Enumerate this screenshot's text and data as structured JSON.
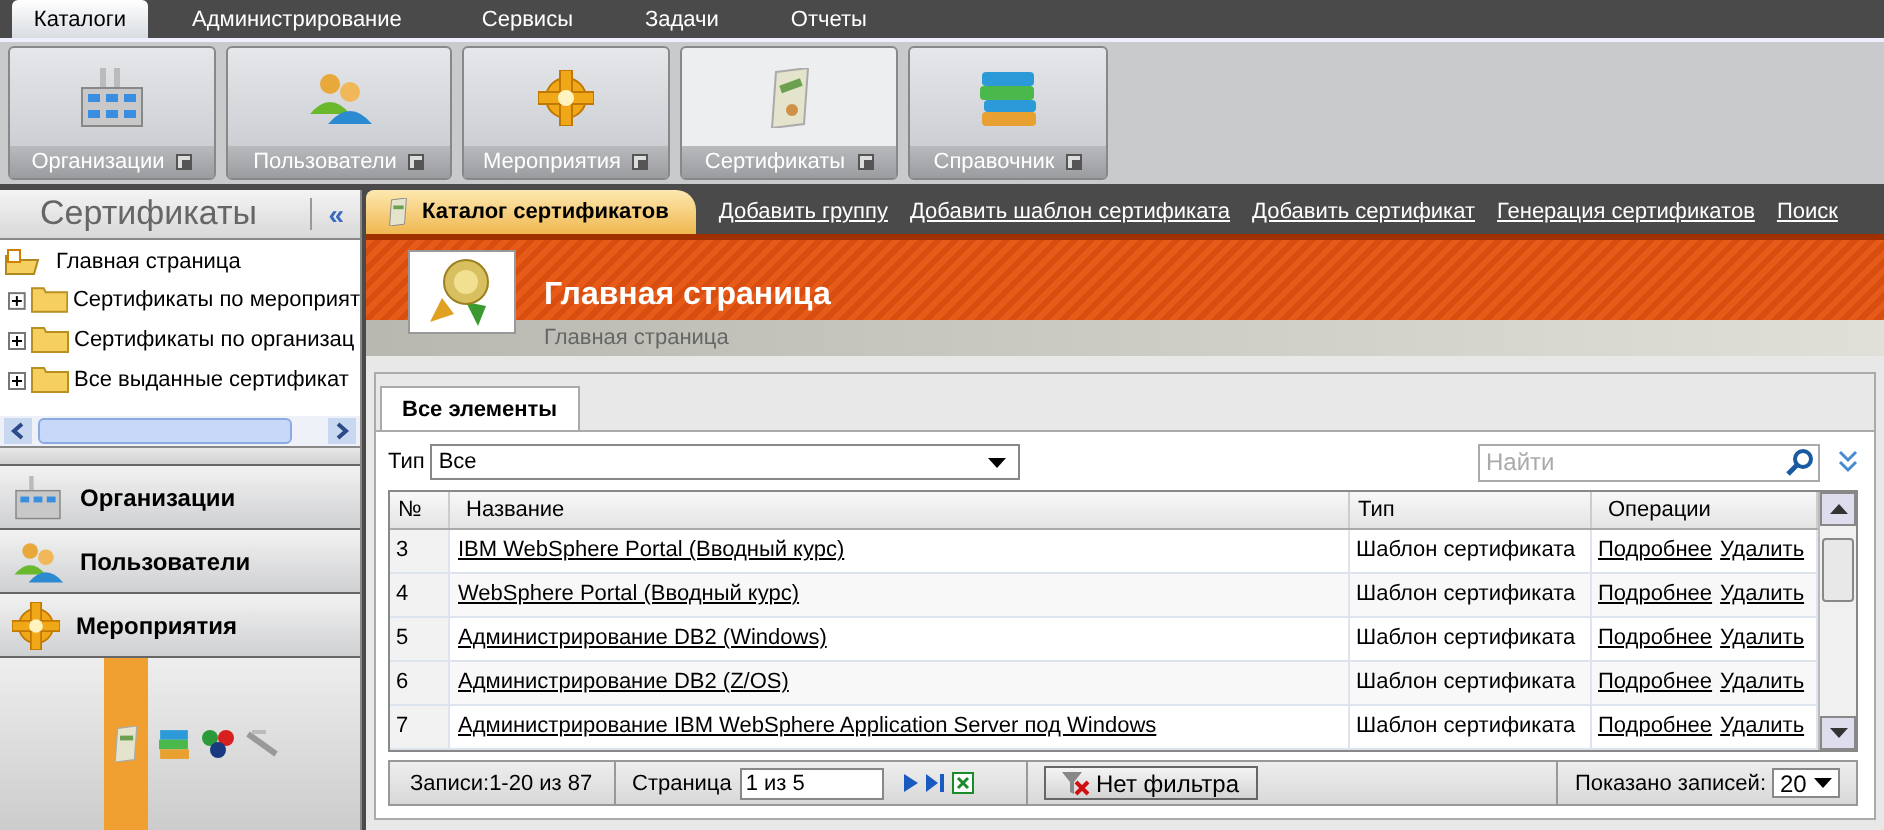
{
  "top_tabs": [
    {
      "label": "Каталоги",
      "selected": true
    },
    {
      "label": "Администрирование",
      "selected": false
    },
    {
      "label": "Сервисы",
      "selected": false
    },
    {
      "label": "Задачи",
      "selected": false
    },
    {
      "label": "Отчеты",
      "selected": false
    }
  ],
  "ribbon": [
    {
      "label": "Организации",
      "selected": false
    },
    {
      "label": "Пользователи",
      "selected": false
    },
    {
      "label": "Мероприятия",
      "selected": false
    },
    {
      "label": "Сертификаты",
      "selected": true
    },
    {
      "label": "Справочник",
      "selected": false
    }
  ],
  "sidebar": {
    "title": "Сертификаты",
    "collapse": "«",
    "tree": {
      "label": "Главная страница",
      "children": [
        {
          "label": "Сертификаты по мероприят",
          "expanded": false
        },
        {
          "label": "Сертификаты по организац",
          "expanded": false
        },
        {
          "label": "Все выданные сертификат",
          "expanded": false
        }
      ]
    },
    "accordion": [
      {
        "label": "Организации"
      },
      {
        "label": "Пользователи"
      },
      {
        "label": "Мероприятия"
      }
    ],
    "bottom_icons": [
      {
        "selected": true
      },
      {
        "selected": false
      },
      {
        "selected": false
      },
      {
        "selected": false
      }
    ]
  },
  "toolbar": {
    "active": "Каталог сертификатов",
    "links": [
      "Добавить группу",
      "Добавить шаблон сертификата",
      "Добавить сертификат",
      "Генерация сертификатов",
      "Поиск"
    ]
  },
  "header": {
    "title": "Главная страница",
    "breadcrumb": "Главная страница"
  },
  "panel": {
    "tabs": [
      {
        "label": "Все элементы",
        "selected": true
      }
    ],
    "filter": {
      "label": "Тип",
      "value": "Все"
    },
    "search": {
      "placeholder": "Найти"
    },
    "table": {
      "columns": [
        "№",
        "Название",
        "Тип",
        "Операции"
      ],
      "rows": [
        {
          "number": "3",
          "name": "IBM WebSphere Portal (Вводный курс)",
          "type": "Шаблон сертификата",
          "actions": [
            "Подробнее",
            "Удалить"
          ]
        },
        {
          "number": "4",
          "name": "WebSphere Portal (Вводный курс)",
          "type": "Шаблон сертификата",
          "actions": [
            "Подробнее",
            "Удалить"
          ]
        },
        {
          "number": "5",
          "name": "Администрирование DB2 (Windows)",
          "type": "Шаблон сертификата",
          "actions": [
            "Подробнее",
            "Удалить"
          ]
        },
        {
          "number": "6",
          "name": "Администрирование DB2 (Z/OS)",
          "type": "Шаблон сертификата",
          "actions": [
            "Подробнее",
            "Удалить"
          ]
        },
        {
          "number": "7",
          "name": "Администрирование IBM WebSphere Application Server под Windows",
          "type": "Шаблон сертификата",
          "actions": [
            "Подробнее",
            "Удалить"
          ]
        }
      ]
    },
    "footer": {
      "records": "Записи:1-20 из 87",
      "page_label": "Страница",
      "page_value": "1 из 5",
      "filter_button": "Нет фильтра",
      "shown_label": "Показано записей:",
      "shown_value": "20"
    }
  }
}
